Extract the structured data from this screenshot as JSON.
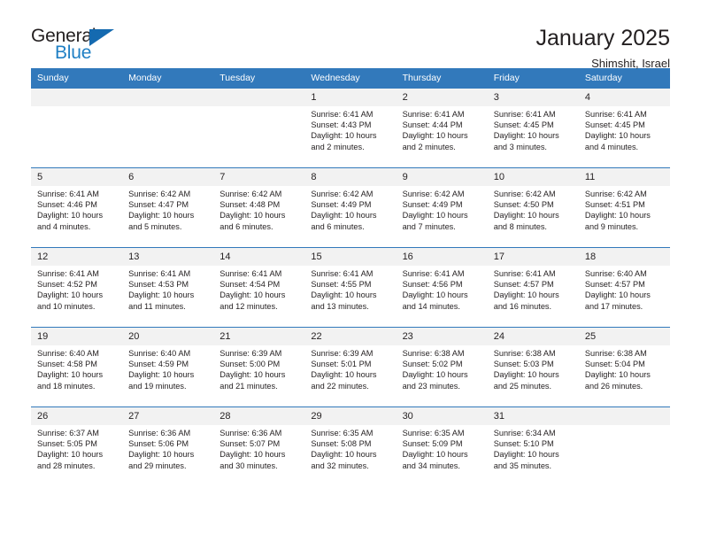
{
  "logo": {
    "word_top": "General",
    "word_bottom": "Blue",
    "triangle_color": "#156ab0",
    "blue_color": "#1f7fc4"
  },
  "header": {
    "title": "January 2025",
    "subtitle": "Shimshit, Israel"
  },
  "colors": {
    "header_bar": "#3279bb",
    "daynum_bg": "#f2f2f2",
    "text": "#231f20"
  },
  "weekdays": [
    "Sunday",
    "Monday",
    "Tuesday",
    "Wednesday",
    "Thursday",
    "Friday",
    "Saturday"
  ],
  "labels": {
    "sunrise": "Sunrise:",
    "sunset": "Sunset:",
    "daylight": "Daylight:"
  },
  "weeks": [
    [
      {
        "day": "",
        "sunrise": "",
        "sunset": "",
        "daylight": ""
      },
      {
        "day": "",
        "sunrise": "",
        "sunset": "",
        "daylight": ""
      },
      {
        "day": "",
        "sunrise": "",
        "sunset": "",
        "daylight": ""
      },
      {
        "day": "1",
        "sunrise": "Sunrise: 6:41 AM",
        "sunset": "Sunset: 4:43 PM",
        "daylight": "Daylight: 10 hours and 2 minutes."
      },
      {
        "day": "2",
        "sunrise": "Sunrise: 6:41 AM",
        "sunset": "Sunset: 4:44 PM",
        "daylight": "Daylight: 10 hours and 2 minutes."
      },
      {
        "day": "3",
        "sunrise": "Sunrise: 6:41 AM",
        "sunset": "Sunset: 4:45 PM",
        "daylight": "Daylight: 10 hours and 3 minutes."
      },
      {
        "day": "4",
        "sunrise": "Sunrise: 6:41 AM",
        "sunset": "Sunset: 4:45 PM",
        "daylight": "Daylight: 10 hours and 4 minutes."
      }
    ],
    [
      {
        "day": "5",
        "sunrise": "Sunrise: 6:41 AM",
        "sunset": "Sunset: 4:46 PM",
        "daylight": "Daylight: 10 hours and 4 minutes."
      },
      {
        "day": "6",
        "sunrise": "Sunrise: 6:42 AM",
        "sunset": "Sunset: 4:47 PM",
        "daylight": "Daylight: 10 hours and 5 minutes."
      },
      {
        "day": "7",
        "sunrise": "Sunrise: 6:42 AM",
        "sunset": "Sunset: 4:48 PM",
        "daylight": "Daylight: 10 hours and 6 minutes."
      },
      {
        "day": "8",
        "sunrise": "Sunrise: 6:42 AM",
        "sunset": "Sunset: 4:49 PM",
        "daylight": "Daylight: 10 hours and 6 minutes."
      },
      {
        "day": "9",
        "sunrise": "Sunrise: 6:42 AM",
        "sunset": "Sunset: 4:49 PM",
        "daylight": "Daylight: 10 hours and 7 minutes."
      },
      {
        "day": "10",
        "sunrise": "Sunrise: 6:42 AM",
        "sunset": "Sunset: 4:50 PM",
        "daylight": "Daylight: 10 hours and 8 minutes."
      },
      {
        "day": "11",
        "sunrise": "Sunrise: 6:42 AM",
        "sunset": "Sunset: 4:51 PM",
        "daylight": "Daylight: 10 hours and 9 minutes."
      }
    ],
    [
      {
        "day": "12",
        "sunrise": "Sunrise: 6:41 AM",
        "sunset": "Sunset: 4:52 PM",
        "daylight": "Daylight: 10 hours and 10 minutes."
      },
      {
        "day": "13",
        "sunrise": "Sunrise: 6:41 AM",
        "sunset": "Sunset: 4:53 PM",
        "daylight": "Daylight: 10 hours and 11 minutes."
      },
      {
        "day": "14",
        "sunrise": "Sunrise: 6:41 AM",
        "sunset": "Sunset: 4:54 PM",
        "daylight": "Daylight: 10 hours and 12 minutes."
      },
      {
        "day": "15",
        "sunrise": "Sunrise: 6:41 AM",
        "sunset": "Sunset: 4:55 PM",
        "daylight": "Daylight: 10 hours and 13 minutes."
      },
      {
        "day": "16",
        "sunrise": "Sunrise: 6:41 AM",
        "sunset": "Sunset: 4:56 PM",
        "daylight": "Daylight: 10 hours and 14 minutes."
      },
      {
        "day": "17",
        "sunrise": "Sunrise: 6:41 AM",
        "sunset": "Sunset: 4:57 PM",
        "daylight": "Daylight: 10 hours and 16 minutes."
      },
      {
        "day": "18",
        "sunrise": "Sunrise: 6:40 AM",
        "sunset": "Sunset: 4:57 PM",
        "daylight": "Daylight: 10 hours and 17 minutes."
      }
    ],
    [
      {
        "day": "19",
        "sunrise": "Sunrise: 6:40 AM",
        "sunset": "Sunset: 4:58 PM",
        "daylight": "Daylight: 10 hours and 18 minutes."
      },
      {
        "day": "20",
        "sunrise": "Sunrise: 6:40 AM",
        "sunset": "Sunset: 4:59 PM",
        "daylight": "Daylight: 10 hours and 19 minutes."
      },
      {
        "day": "21",
        "sunrise": "Sunrise: 6:39 AM",
        "sunset": "Sunset: 5:00 PM",
        "daylight": "Daylight: 10 hours and 21 minutes."
      },
      {
        "day": "22",
        "sunrise": "Sunrise: 6:39 AM",
        "sunset": "Sunset: 5:01 PM",
        "daylight": "Daylight: 10 hours and 22 minutes."
      },
      {
        "day": "23",
        "sunrise": "Sunrise: 6:38 AM",
        "sunset": "Sunset: 5:02 PM",
        "daylight": "Daylight: 10 hours and 23 minutes."
      },
      {
        "day": "24",
        "sunrise": "Sunrise: 6:38 AM",
        "sunset": "Sunset: 5:03 PM",
        "daylight": "Daylight: 10 hours and 25 minutes."
      },
      {
        "day": "25",
        "sunrise": "Sunrise: 6:38 AM",
        "sunset": "Sunset: 5:04 PM",
        "daylight": "Daylight: 10 hours and 26 minutes."
      }
    ],
    [
      {
        "day": "26",
        "sunrise": "Sunrise: 6:37 AM",
        "sunset": "Sunset: 5:05 PM",
        "daylight": "Daylight: 10 hours and 28 minutes."
      },
      {
        "day": "27",
        "sunrise": "Sunrise: 6:36 AM",
        "sunset": "Sunset: 5:06 PM",
        "daylight": "Daylight: 10 hours and 29 minutes."
      },
      {
        "day": "28",
        "sunrise": "Sunrise: 6:36 AM",
        "sunset": "Sunset: 5:07 PM",
        "daylight": "Daylight: 10 hours and 30 minutes."
      },
      {
        "day": "29",
        "sunrise": "Sunrise: 6:35 AM",
        "sunset": "Sunset: 5:08 PM",
        "daylight": "Daylight: 10 hours and 32 minutes."
      },
      {
        "day": "30",
        "sunrise": "Sunrise: 6:35 AM",
        "sunset": "Sunset: 5:09 PM",
        "daylight": "Daylight: 10 hours and 34 minutes."
      },
      {
        "day": "31",
        "sunrise": "Sunrise: 6:34 AM",
        "sunset": "Sunset: 5:10 PM",
        "daylight": "Daylight: 10 hours and 35 minutes."
      },
      {
        "day": "",
        "sunrise": "",
        "sunset": "",
        "daylight": ""
      }
    ]
  ]
}
